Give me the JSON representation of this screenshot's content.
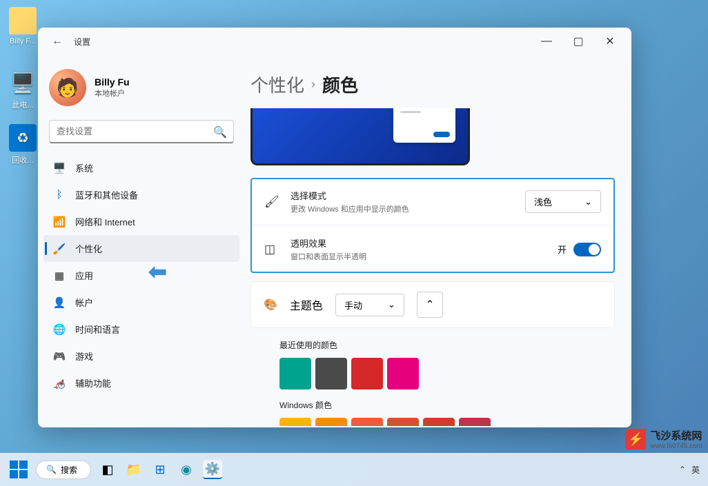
{
  "desktop": {
    "icon1": "Billy F...",
    "icon2": "此电...",
    "icon3": "回收..."
  },
  "window": {
    "title": "设置",
    "profile": {
      "name": "Billy Fu",
      "sub": "本地帐户"
    },
    "search_placeholder": "查找设置",
    "nav": {
      "system": "系统",
      "bluetooth": "蓝牙和其他设备",
      "network": "网络和 Internet",
      "personalization": "个性化",
      "apps": "应用",
      "accounts": "帐户",
      "timelang": "时间和语言",
      "gaming": "游戏",
      "accessibility": "辅助功能"
    },
    "breadcrumb": {
      "parent": "个性化",
      "current": "颜色"
    },
    "mode": {
      "title": "选择模式",
      "desc": "更改 Windows 和应用中显示的颜色",
      "value": "浅色"
    },
    "transparency": {
      "title": "透明效果",
      "desc": "窗口和表面显示半透明",
      "state": "开"
    },
    "accent": {
      "title": "主题色",
      "value": "手动"
    },
    "recent": {
      "label": "最近使用的颜色",
      "colors": [
        "#00a38e",
        "#4a4a4a",
        "#d62828",
        "#e6007e"
      ]
    },
    "windows_colors": {
      "label": "Windows 颜色",
      "colors": [
        "#ffb300",
        "#ff8a00",
        "#f25c2e",
        "#d94f2e",
        "#d43a2e",
        "#c4314b"
      ]
    }
  },
  "taskbar": {
    "search": "搜索",
    "lang": "英"
  },
  "brand": {
    "name": "飞沙系统网",
    "url": "www.fs0745.com"
  }
}
